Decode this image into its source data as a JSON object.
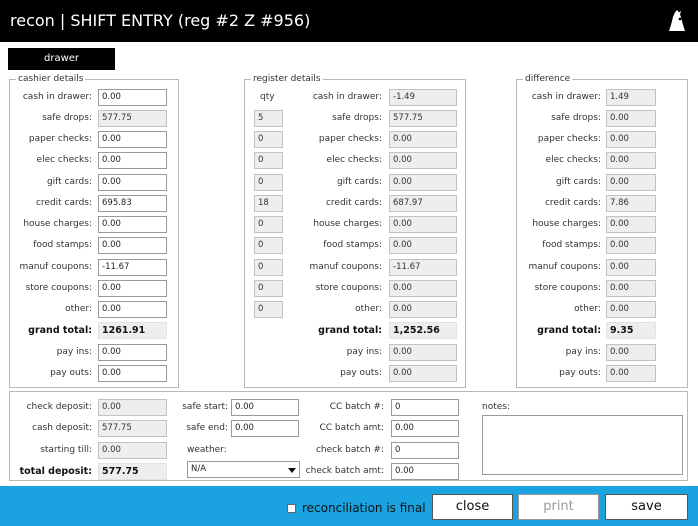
{
  "title": "recon | SHIFT ENTRY  (reg #2  Z #956)",
  "tab": "drawer",
  "rows": [
    "cash in drawer:",
    "safe drops:",
    "paper checks:",
    "elec checks:",
    "gift cards:",
    "credit cards:",
    "house charges:",
    "food stamps:",
    "manuf coupons:",
    "store coupons:",
    "other:"
  ],
  "grand_total_label": "grand total:",
  "pay_ins_label": "pay ins:",
  "pay_outs_label": "pay outs:",
  "cashier": {
    "title": "cashier details",
    "values": [
      "0.00",
      "577.75",
      "0.00",
      "0.00",
      "0.00",
      "695.83",
      "0.00",
      "0.00",
      "-11.67",
      "0.00",
      "0.00"
    ],
    "grand_total": "1261.91",
    "pay_ins": "0.00",
    "pay_outs": "0.00"
  },
  "register": {
    "title": "register details",
    "qty_label": "qty",
    "qty": [
      "5",
      "0",
      "0",
      "0",
      "18",
      "0",
      "0",
      "0",
      "0",
      "0"
    ],
    "values": [
      "-1.49",
      "577.75",
      "0.00",
      "0.00",
      "0.00",
      "687.97",
      "0.00",
      "0.00",
      "-11.67",
      "0.00",
      "0.00"
    ],
    "grand_total": "1,252.56",
    "pay_ins": "0.00",
    "pay_outs": "0.00"
  },
  "difference": {
    "title": "difference",
    "values": [
      "1.49",
      "0.00",
      "0.00",
      "0.00",
      "0.00",
      "7.86",
      "0.00",
      "0.00",
      "0.00",
      "0.00",
      "0.00"
    ],
    "grand_total": "9.35",
    "pay_ins": "0.00",
    "pay_outs": "0.00"
  },
  "bottom": {
    "check_deposit_label": "check deposit:",
    "check_deposit": "0.00",
    "cash_deposit_label": "cash deposit:",
    "cash_deposit": "577.75",
    "starting_till_label": "starting till:",
    "starting_till": "0.00",
    "total_deposit_label": "total deposit:",
    "total_deposit": "577.75",
    "safe_start_label": "safe start:",
    "safe_start": "0.00",
    "safe_end_label": "safe end:",
    "safe_end": "0.00",
    "weather_label": "weather:",
    "weather": "N/A",
    "cc_batch_no_label": "CC batch #:",
    "cc_batch_no": "0",
    "cc_batch_amt_label": "CC batch amt:",
    "cc_batch_amt": "0.00",
    "check_batch_no_label": "check batch #:",
    "check_batch_no": "0",
    "check_batch_amt_label": "check batch amt:",
    "check_batch_amt": "0.00",
    "notes_label": "notes:"
  },
  "footer": {
    "final_label": "reconciliation is final",
    "close": "close",
    "print": "print",
    "save": "save"
  },
  "colors": {
    "titlebar": "#000000",
    "footer": "#1aa3e0",
    "readonly_field": "#eeeeee"
  }
}
